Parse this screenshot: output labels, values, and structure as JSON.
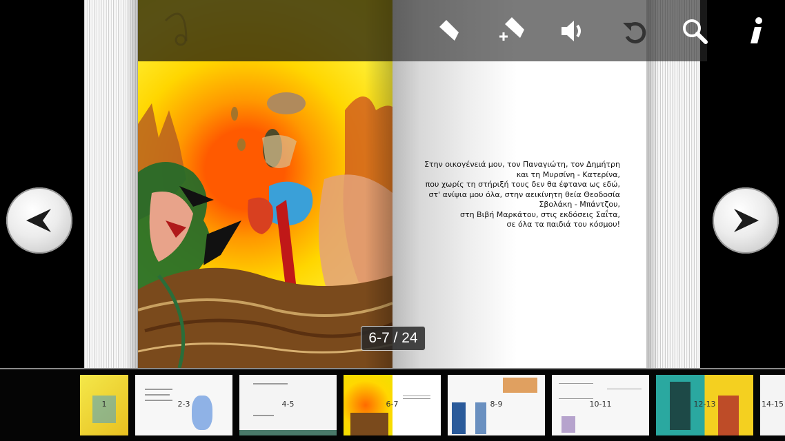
{
  "reader": {
    "page_indicator": "6-7 / 24"
  },
  "toolbar": {
    "icons": [
      "bookmark-icon",
      "add-bookmark-icon",
      "sound-icon",
      "undo-icon",
      "search-icon",
      "info-icon"
    ]
  },
  "navigation": {
    "prev_icon": "arrow-left-icon",
    "next_icon": "arrow-right-icon"
  },
  "dedication": {
    "lines": [
      "Στην οικογένειά μου, τον Παναγιώτη, τον Δημήτρη",
      "και τη Μυρσίνη - Κατερίνα,",
      "που χωρίς τη στήριξή τους δεν θα έφτανα ως εδώ,",
      "στ' ανίψια μου όλα, στην αεικίνητη θεία Θεοδοσία",
      "Σβολάκη - Μπάντζου,",
      "στη Βιβή Μαρκάτου, στις εκδόσεις Σαΐτα,",
      "σε όλα τα παιδιά του κόσμου!"
    ]
  },
  "thumbnails": [
    {
      "label": "1"
    },
    {
      "label": "2-3"
    },
    {
      "label": "4-5"
    },
    {
      "label": "6-7"
    },
    {
      "label": "8-9"
    },
    {
      "label": "10-11"
    },
    {
      "label": "12-13"
    },
    {
      "label": "14-15"
    }
  ],
  "colors": {
    "accent": "#fff23a",
    "toolbar_bg": "#3a3a3a"
  }
}
